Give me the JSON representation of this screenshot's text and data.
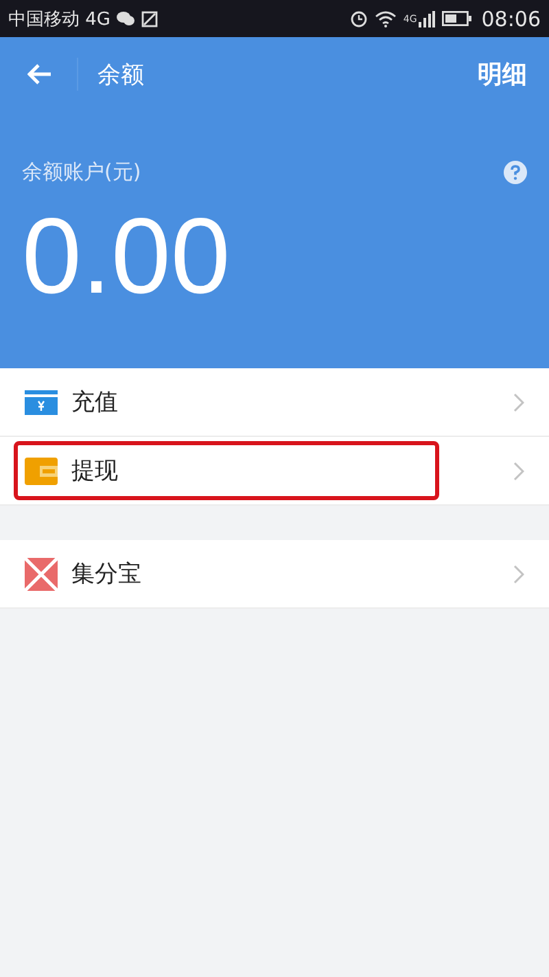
{
  "status_bar": {
    "carrier": "中国移动 4G",
    "network_label": "4G",
    "time": "08:06"
  },
  "nav": {
    "title": "余额",
    "action": "明细"
  },
  "balance": {
    "label": "余额账户(元)",
    "amount": "0.00"
  },
  "sections": [
    [
      {
        "kind": "recharge",
        "label": "充值",
        "highlighted": false
      },
      {
        "kind": "withdraw",
        "label": "提现",
        "highlighted": true
      }
    ],
    [
      {
        "kind": "points",
        "label": "集分宝",
        "highlighted": false
      }
    ]
  ]
}
